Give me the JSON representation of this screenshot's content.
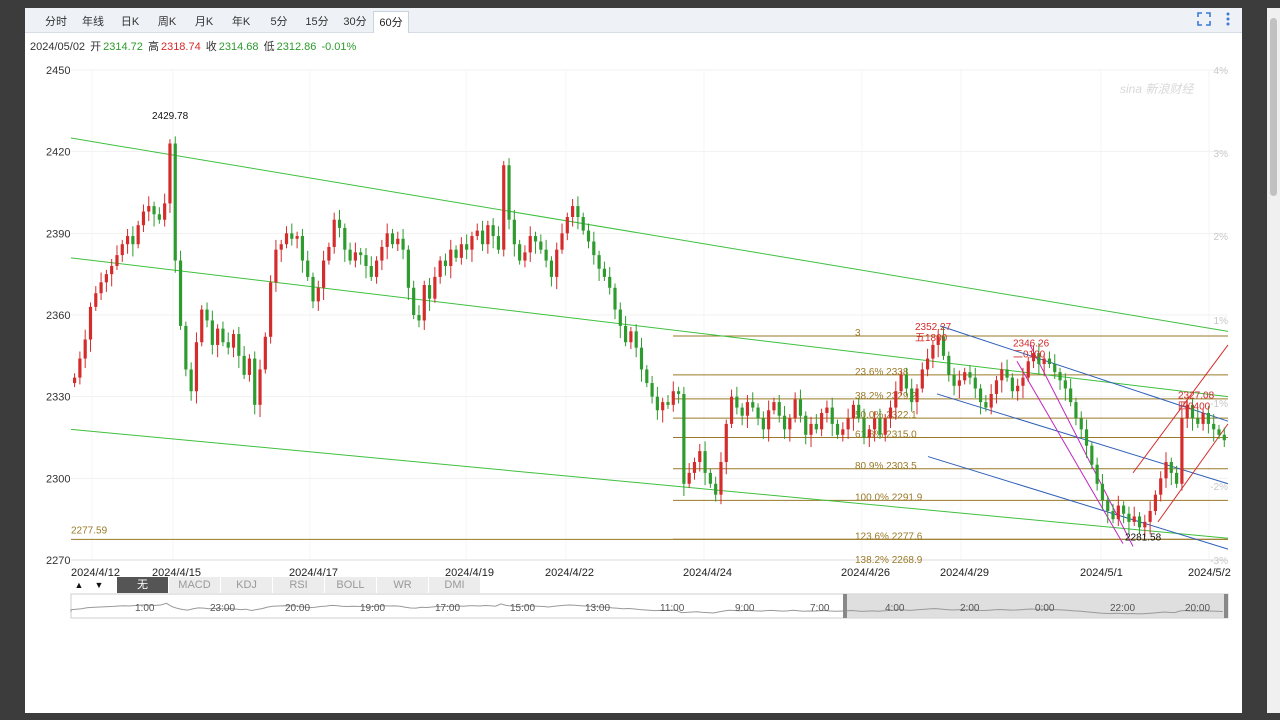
{
  "tabs": [
    {
      "label": "分时",
      "active": false
    },
    {
      "label": "年线",
      "active": false
    },
    {
      "label": "日K",
      "active": false
    },
    {
      "label": "周K",
      "active": false
    },
    {
      "label": "月K",
      "active": false
    },
    {
      "label": "年K",
      "active": false
    },
    {
      "label": "5分",
      "active": false
    },
    {
      "label": "15分",
      "active": false
    },
    {
      "label": "30分",
      "active": false
    },
    {
      "label": "60分",
      "active": true
    }
  ],
  "header_icons": {
    "fullscreen": "fullscreen-icon",
    "more": "more-vertical-icon"
  },
  "quote": {
    "date": "2024/05/02",
    "open_label": "开",
    "open": "2314.72",
    "high_label": "高",
    "high": "2318.74",
    "close_label": "收",
    "close": "2314.68",
    "low_label": "低",
    "low": "2312.86",
    "change": "-0.01%"
  },
  "watermark": "sina 新浪财经",
  "colors": {
    "up": "#d42b2b",
    "down": "#2d9b2d",
    "channel": "#3ec03e",
    "fib": "#9a7a28",
    "trend_blue": "#2e5fb8",
    "trend_magenta": "#c026c0",
    "trend_red": "#d42b2b"
  },
  "chart_data": {
    "type": "candlestick",
    "period": "60分",
    "ylim": [
      2270,
      2450
    ],
    "y_ticks": [
      "2450",
      "2420",
      "2390",
      "2360",
      "2330",
      "2300",
      "2270"
    ],
    "pct_ticks": [
      "4%",
      "3%",
      "2%",
      "1%",
      "-1%",
      "-2%",
      "-3%"
    ],
    "x_ticks": [
      "2024/4/12",
      "2024/4/15",
      "2024/4/17",
      "2024/4/19",
      "2024/4/22",
      "2024/4/24",
      "2024/4/26",
      "2024/4/29",
      "2024/5/1",
      "2024/5/2"
    ],
    "closes": [
      2337,
      2344,
      2351,
      2363,
      2368,
      2372,
      2375,
      2378,
      2382,
      2386,
      2389,
      2386,
      2393,
      2398,
      2400,
      2397,
      2395,
      2401,
      2423,
      2380,
      2356,
      2340,
      2332,
      2350,
      2362,
      2358,
      2349,
      2355,
      2350,
      2348,
      2353,
      2345,
      2338,
      2344,
      2327,
      2340,
      2352,
      2372,
      2384,
      2386,
      2390,
      2388,
      2389,
      2380,
      2374,
      2365,
      2370,
      2380,
      2385,
      2395,
      2392,
      2384,
      2380,
      2383,
      2382,
      2378,
      2374,
      2380,
      2385,
      2390,
      2386,
      2388,
      2384,
      2370,
      2360,
      2358,
      2371,
      2366,
      2374,
      2380,
      2378,
      2384,
      2381,
      2386,
      2384,
      2389,
      2391,
      2386,
      2393,
      2389,
      2384,
      2415,
      2395,
      2386,
      2380,
      2383,
      2389,
      2387,
      2384,
      2380,
      2374,
      2384,
      2390,
      2396,
      2400,
      2396,
      2391,
      2387,
      2382,
      2377,
      2374,
      2370,
      2362,
      2356,
      2350,
      2354,
      2348,
      2340,
      2335,
      2330,
      2325,
      2328,
      2327,
      2332,
      2331,
      2298,
      2302,
      2306,
      2310,
      2302,
      2298,
      2294,
      2306,
      2320,
      2330,
      2326,
      2323,
      2328,
      2326,
      2322,
      2318,
      2325,
      2328,
      2323,
      2318,
      2322,
      2329,
      2323,
      2316,
      2320,
      2318,
      2324,
      2326,
      2320,
      2316,
      2318,
      2322,
      2327,
      2322,
      2315,
      2318,
      2322,
      2316,
      2322,
      2326,
      2332,
      2338,
      2333,
      2328,
      2333,
      2340,
      2344,
      2349,
      2352,
      2345,
      2338,
      2334,
      2336,
      2339,
      2337,
      2333,
      2328,
      2326,
      2331,
      2336,
      2340,
      2337,
      2332,
      2334,
      2337,
      2343,
      2346,
      2342,
      2344,
      2342,
      2339,
      2336,
      2333,
      2328,
      2322,
      2318,
      2312,
      2305,
      2298,
      2292,
      2288,
      2285,
      2290,
      2287,
      2284,
      2286,
      2282,
      2284,
      2288,
      2294,
      2300,
      2306,
      2302,
      2298,
      2322,
      2327,
      2322,
      2320,
      2324,
      2320,
      2318,
      2316,
      2314
    ],
    "annotations": [
      {
        "price": "2429.78",
        "label": ""
      },
      {
        "price": "2352.27",
        "label": "五1800"
      },
      {
        "price": "2346.26",
        "label": "二0100"
      },
      {
        "price": "2327.08",
        "label": "四0400"
      },
      {
        "price": "2281.58",
        "label": ""
      },
      {
        "price": "2277.59",
        "label": ""
      }
    ],
    "fib_levels": [
      {
        "label": "3",
        "value": 2352.3
      },
      {
        "label": "23.6% 2338",
        "value": 2338.0
      },
      {
        "label": "38.2% 2329.2",
        "value": 2329.2
      },
      {
        "label": "50.0% 2322.1",
        "value": 2322.1
      },
      {
        "label": "61.8% 2315.0",
        "value": 2315.0
      },
      {
        "label": "80.9% 2303.5",
        "value": 2303.5
      },
      {
        "label": "100.0% 2291.9",
        "value": 2291.9
      },
      {
        "label": "123.6% 2277.6",
        "value": 2277.6
      },
      {
        "label": "138.2% 2268.9",
        "value": 2268.9
      }
    ],
    "base_price": 2277.59
  },
  "indicator_bar": {
    "up_arrow": "▲",
    "down_arrow": "▼",
    "items": [
      {
        "label": "无",
        "active": true
      },
      {
        "label": "MACD",
        "active": false
      },
      {
        "label": "KDJ",
        "active": false
      },
      {
        "label": "RSI",
        "active": false
      },
      {
        "label": "BOLL",
        "active": false
      },
      {
        "label": "WR",
        "active": false
      },
      {
        "label": "DMI",
        "active": false
      }
    ]
  },
  "navigator": {
    "time_labels": [
      "1:00",
      "23:00",
      "20:00",
      "19:00",
      "17:00",
      "15:00",
      "13:00",
      "11:00",
      "9:00",
      "7:00",
      "4:00",
      "2:00",
      "0:00",
      "22:00",
      "20:00"
    ]
  }
}
